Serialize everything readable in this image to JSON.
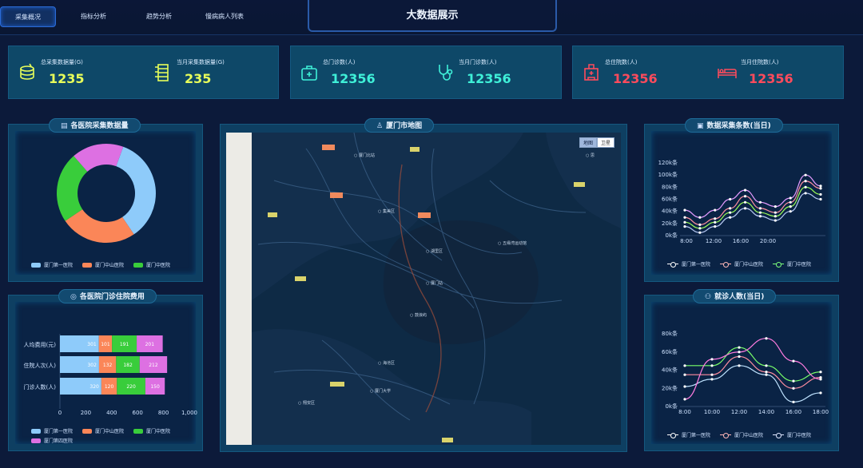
{
  "nav": {
    "items": [
      "采集概况",
      "指标分析",
      "趋势分析",
      "慢病病人列表"
    ],
    "active_index": 0
  },
  "header": {
    "title": "大数据展示"
  },
  "kpis": [
    {
      "label": "总采集数据量(G)",
      "value": "1235",
      "color": "#e8ff5a",
      "icon": "database-icon"
    },
    {
      "label": "当月采集数据量(G)",
      "value": "235",
      "color": "#e8ff5a",
      "icon": "server-rack-icon"
    },
    {
      "label": "总门诊数(人)",
      "value": "12356",
      "color": "#3ff0d8",
      "icon": "medical-kit-icon"
    },
    {
      "label": "当月门诊数(人)",
      "value": "12356",
      "color": "#3ff0d8",
      "icon": "stethoscope-icon"
    },
    {
      "label": "总住院数(人)",
      "value": "12356",
      "color": "#ff4b5c",
      "icon": "hospital-icon"
    },
    {
      "label": "当月住院数(人)",
      "value": "12356",
      "color": "#ff4b5c",
      "icon": "bed-icon"
    }
  ],
  "panels": {
    "donut": {
      "title": "各医院采集数据量",
      "icon": "document-icon"
    },
    "bars": {
      "title": "各医院门诊住院费用",
      "icon": "target-icon"
    },
    "map": {
      "title": "厦门市地图",
      "icon": "person-pin-icon",
      "toggle": [
        "地图",
        "卫星"
      ]
    },
    "line1": {
      "title": "数据采集条数(当日)",
      "icon": "chart-icon"
    },
    "line2": {
      "title": "就诊人数(当日)",
      "icon": "crowd-icon"
    }
  },
  "colors": {
    "first": "#8ecbfa",
    "zhongshan": "#fb8658",
    "zhongyi": "#39cd3b",
    "fourth": "#dd70e2"
  },
  "chart_data": [
    {
      "type": "pie",
      "categories": [
        "厦门第一医院",
        "厦门中山医院",
        "厦门中医院",
        ""
      ],
      "values": [
        35,
        25,
        23,
        17
      ]
    },
    {
      "type": "bar",
      "categories": [
        "门诊人数(人)",
        "住院人次(人)",
        "人均费用(元)"
      ],
      "series": [
        {
          "name": "厦门第一医院",
          "values": [
            320,
            302,
            301
          ]
        },
        {
          "name": "厦门中山医院",
          "values": [
            120,
            132,
            101
          ]
        },
        {
          "name": "厦门中医院",
          "values": [
            220,
            182,
            191
          ]
        },
        {
          "name": "厦门第四医院",
          "values": [
            150,
            212,
            201
          ]
        }
      ],
      "xticks": [
        "0",
        "200",
        "400",
        "600",
        "800",
        "1,000"
      ],
      "xlim": [
        0,
        1000
      ]
    },
    {
      "type": "line",
      "x": [
        "8:00",
        "12:00",
        "16:00",
        "20:00"
      ],
      "yticks": [
        "0k条",
        "20k条",
        "40k条",
        "60k条",
        "80k条",
        "100k条",
        "120k条"
      ],
      "ylim": [
        0,
        120
      ],
      "series": [
        {
          "name": "厦门第一医院",
          "values": [
            15,
            5,
            15,
            30,
            45,
            32,
            25,
            40,
            70,
            60
          ]
        },
        {
          "name": "厦门中山医院",
          "values": [
            30,
            18,
            28,
            45,
            65,
            45,
            38,
            55,
            90,
            78
          ]
        },
        {
          "name": "厦门中医院",
          "values": [
            22,
            12,
            22,
            38,
            55,
            38,
            32,
            48,
            80,
            68
          ]
        },
        {
          "name": "",
          "values": [
            42,
            30,
            42,
            60,
            75,
            55,
            48,
            62,
            100,
            82
          ]
        }
      ]
    },
    {
      "type": "line",
      "x": [
        "8:00",
        "10:00",
        "12:00",
        "14:00",
        "16:00",
        "18:00"
      ],
      "yticks": [
        "0k条",
        "20k条",
        "40k条",
        "60k条",
        "80k条"
      ],
      "ylim": [
        0,
        80
      ],
      "series": [
        {
          "name": "厦门第一医院",
          "values": [
            22,
            30,
            45,
            35,
            5,
            15
          ]
        },
        {
          "name": "厦门中山医院",
          "values": [
            35,
            35,
            55,
            38,
            20,
            32
          ]
        },
        {
          "name": "厦门中医院",
          "values": [
            45,
            45,
            65,
            45,
            28,
            38
          ]
        },
        {
          "name": "",
          "values": [
            8,
            52,
            60,
            75,
            50,
            30
          ]
        }
      ]
    }
  ]
}
